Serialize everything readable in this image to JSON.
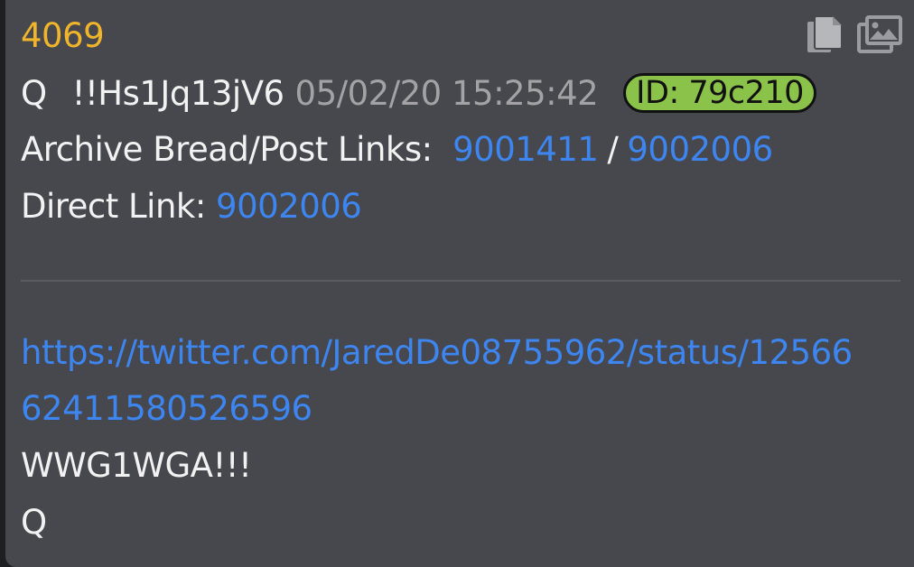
{
  "post": {
    "number": "4069",
    "author": "Q",
    "tripcode": "!!Hs1Jq13jV6",
    "timestamp": "05/02/20 15:25:42",
    "id_label": "ID: 79c210",
    "archive_label": "Archive Bread/Post Links:",
    "archive_link_1": "9001411",
    "archive_separator": "/",
    "archive_link_2": "9002006",
    "direct_label": "Direct Link:",
    "direct_link": "9002006",
    "body_link_line_1": "https://twitter.com/JaredDe08755962/status/12566",
    "body_link_line_2": "62411580526596",
    "body_text_1": "WWG1WGA!!!",
    "body_text_2": "Q"
  },
  "icons": {
    "copy": "copy-icon",
    "images": "images-icon"
  },
  "colors": {
    "background": "#47484e",
    "post_number": "#f1b52b",
    "link": "#3d86f2",
    "text": "#f2f2f2",
    "timestamp": "#a3a3a7",
    "id_badge": "#8bc34a"
  }
}
